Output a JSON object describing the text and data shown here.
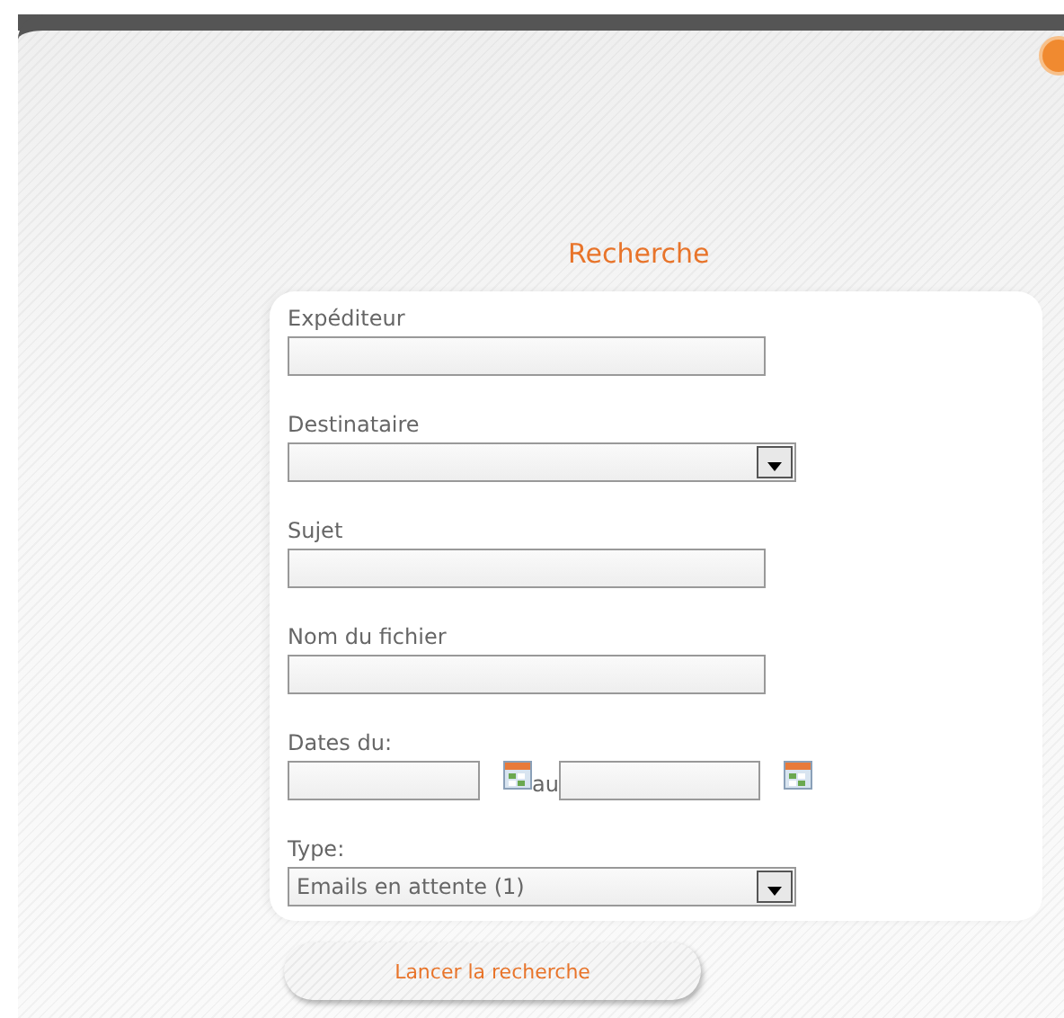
{
  "title": "Recherche",
  "fields": [
    {
      "kind": "text",
      "label": "Expéditeur"
    },
    {
      "kind": "select",
      "label": "Destinataire"
    },
    {
      "kind": "text",
      "label": "Sujet"
    },
    {
      "kind": "text",
      "label": "Nom du fichier"
    },
    {
      "kind": "daterange",
      "label": "Dates du:",
      "separator": "au"
    },
    {
      "kind": "select",
      "label": "Type:",
      "value": "Emails en attente (1)"
    }
  ],
  "button": "Lancer la recherche"
}
